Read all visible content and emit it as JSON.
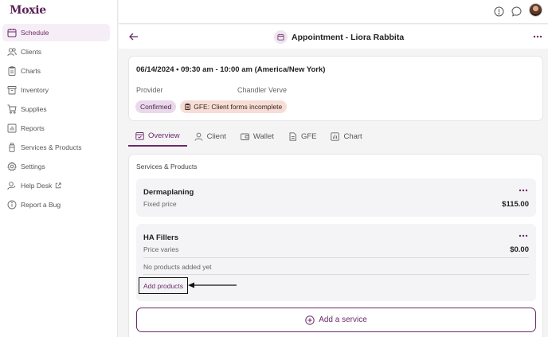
{
  "brand": {
    "logo": "Moxie",
    "accent": "#6b2a68"
  },
  "sidebar": {
    "items": [
      {
        "label": "Schedule",
        "icon": "calendar-icon",
        "active": true
      },
      {
        "label": "Clients",
        "icon": "users-icon"
      },
      {
        "label": "Charts",
        "icon": "clipboard-icon"
      },
      {
        "label": "Inventory",
        "icon": "archive-icon"
      },
      {
        "label": "Supplies",
        "icon": "cart-icon"
      },
      {
        "label": "Reports",
        "icon": "chart-icon"
      },
      {
        "label": "Services & Products",
        "icon": "bottle-icon"
      },
      {
        "label": "Settings",
        "icon": "gear-icon"
      },
      {
        "label": "Help Desk",
        "icon": "user-help-icon",
        "external": true
      },
      {
        "label": "Report a Bug",
        "icon": "info-icon"
      }
    ]
  },
  "topbar": {
    "icons": [
      "info-icon",
      "chat-icon",
      "avatar"
    ]
  },
  "header": {
    "title": "Appointment - Liora Rabbita"
  },
  "appointment": {
    "datetime": "06/14/2024 • 09:30 am - 10:00 am (America/New York)",
    "provider_label": "Provider",
    "provider_name": "Chandler Verve",
    "status_badge": "Confirmed",
    "gfe_badge": "GFE: Client forms incomplete"
  },
  "tabs": [
    {
      "label": "Overview",
      "active": true
    },
    {
      "label": "Client"
    },
    {
      "label": "Wallet"
    },
    {
      "label": "GFE"
    },
    {
      "label": "Chart"
    }
  ],
  "services": {
    "section_title": "Services & Products",
    "items": [
      {
        "name": "Dermaplaning",
        "pricing": "Fixed price",
        "price": "$115.00"
      },
      {
        "name": "HA Fillers",
        "pricing": "Price varies",
        "price": "$0.00",
        "products_empty": "No products added yet",
        "add_products_label": "Add products"
      }
    ],
    "add_service_label": "Add a service"
  }
}
